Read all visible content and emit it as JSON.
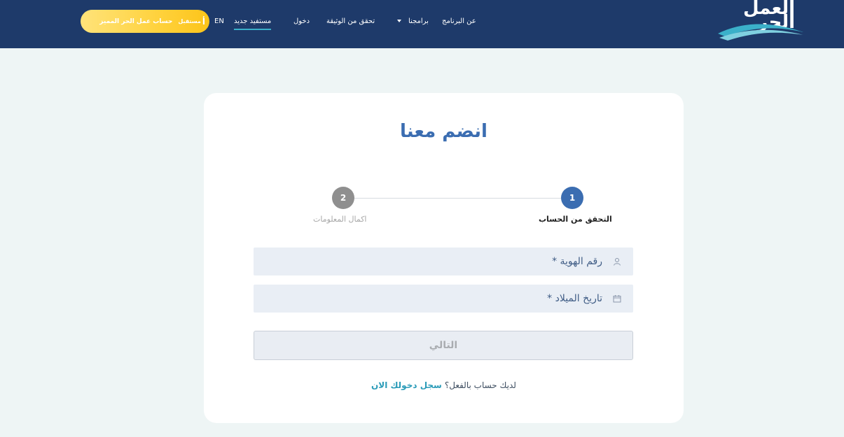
{
  "header": {
    "logo_line1": "العمل",
    "logo_line2": "الحر",
    "nav": {
      "about": "عن البرنامج",
      "programs": "برامجنا",
      "verify_document": "تحقق من الوثيقة",
      "login": "دخول",
      "new_beneficiary": "مستفيد جديد",
      "language": "EN"
    },
    "premium": {
      "label": "حساب عمل الحر المميز",
      "brand_big": "أ",
      "brand_small": "مستقبل"
    }
  },
  "card": {
    "title": "انضم معنا",
    "steps": [
      {
        "number": "1",
        "label": "التحقق من الحساب",
        "state": "active"
      },
      {
        "number": "2",
        "label": "اكمال المعلومات",
        "state": "inactive"
      }
    ],
    "id_field": {
      "placeholder": "رقم الهوية *",
      "value": ""
    },
    "dob_field": {
      "placeholder": "تاريخ الميلاد *",
      "value": ""
    },
    "next_button": "التالي",
    "have_account_text": "لديك حساب بالفعل؟",
    "login_link": "سجل دخولك الان"
  },
  "colors": {
    "header_bg": "#1e3a6a",
    "page_bg": "#eef5f5",
    "accent_blue": "#3b6db1",
    "link_teal": "#2a9bb8",
    "premium_yellow": "#ffd23d"
  },
  "icons": {
    "id_field_icon": "user-icon",
    "dob_field_icon": "calendar-icon",
    "programs_dropdown": "caret-down-icon"
  }
}
